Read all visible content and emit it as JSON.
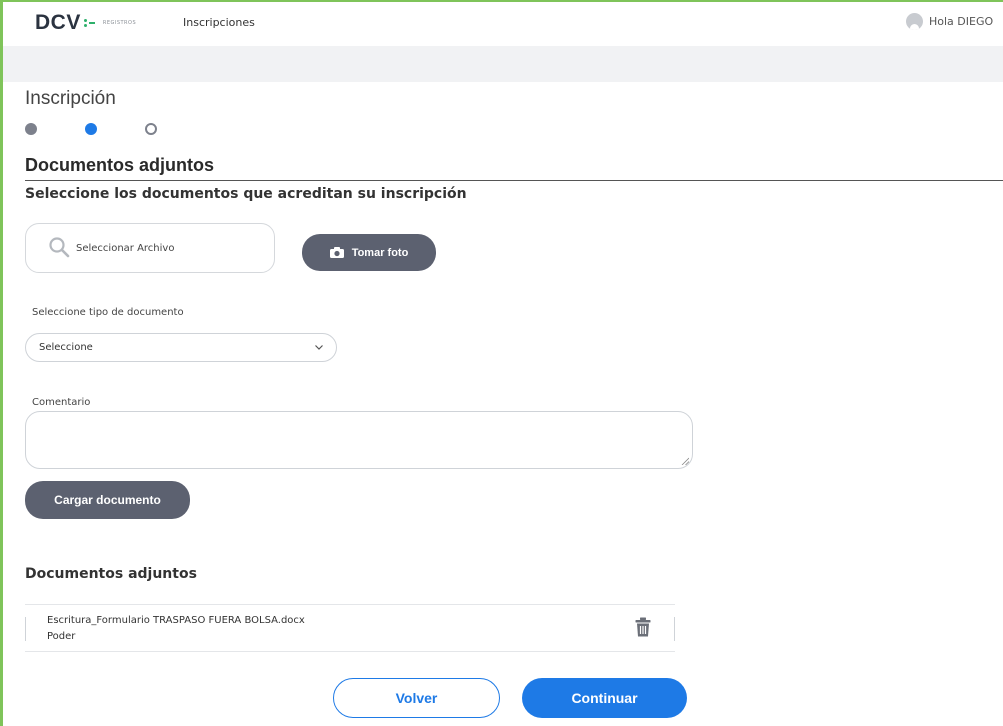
{
  "header": {
    "logo_text": "DCV",
    "logo_subtext": "REGISTROS",
    "nav_link": "Inscripciones",
    "user_greeting": "Hola DIEGO"
  },
  "page": {
    "title": "Inscripción",
    "steps": {
      "total": 3,
      "current": 2
    }
  },
  "section": {
    "title": "Documentos adjuntos",
    "instruction": "Seleccione los documentos que acreditan su inscripción"
  },
  "form": {
    "file_placeholder": "Seleccionar Archivo",
    "photo_button": "Tomar foto",
    "doc_type_label": "Seleccione tipo de documento",
    "doc_type_value": "Seleccione",
    "comment_label": "Comentario",
    "comment_value": "",
    "upload_button": "Cargar documento"
  },
  "attachments": {
    "title": "Documentos adjuntos",
    "items": [
      {
        "file_name": "Escritura_Formulario TRASPASO FUERA BOLSA.docx",
        "doc_type": "Poder"
      }
    ]
  },
  "footer": {
    "back_button": "Volver",
    "continue_button": "Continuar"
  },
  "colors": {
    "primary": "#1e7ae6",
    "dark_button": "#5c6170",
    "brand_green": "#2eb06b"
  }
}
